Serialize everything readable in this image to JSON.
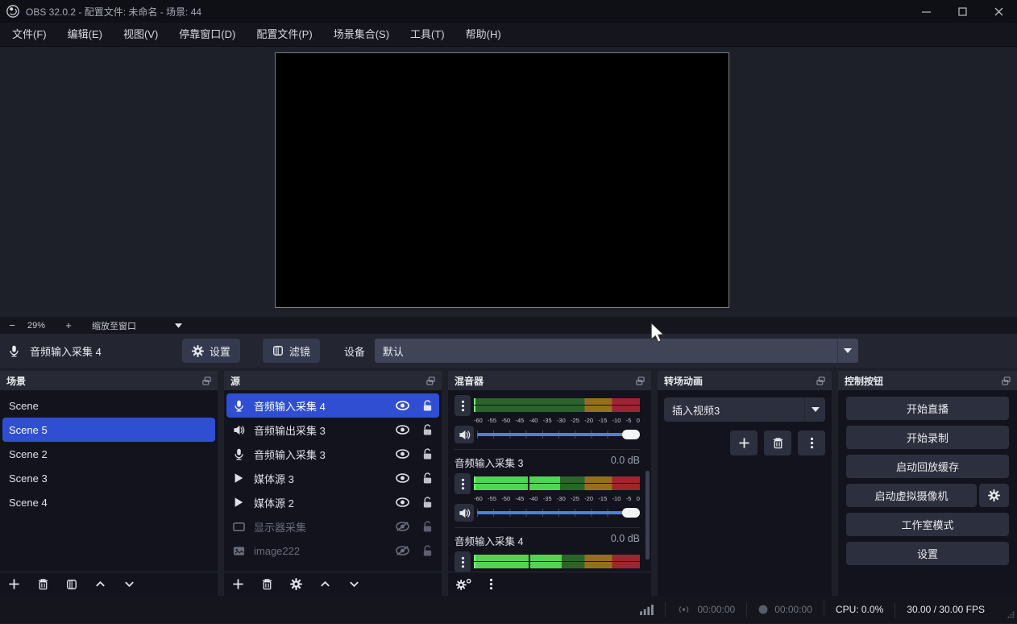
{
  "titlebar": {
    "title": "OBS 32.0.2 - 配置文件: 未命名 - 场景: 44"
  },
  "menubar": {
    "items": [
      "文件(F)",
      "编辑(E)",
      "视图(V)",
      "停靠窗口(D)",
      "配置文件(P)",
      "场景集合(S)",
      "工具(T)",
      "帮助(H)"
    ]
  },
  "preview": {
    "zoom_out": "−",
    "zoom_percent": "29%",
    "zoom_in": "+",
    "zoom_fit": "缩放至窗口"
  },
  "props_bar": {
    "source_name": "音频输入采集 4",
    "settings": "设置",
    "filters": "滤镜",
    "device_label": "设备",
    "device_value": "默认"
  },
  "docks": {
    "scenes": {
      "title": "场景",
      "items": [
        {
          "label": "Scene",
          "selected": false
        },
        {
          "label": "Scene 5",
          "selected": true
        },
        {
          "label": "Scene 2",
          "selected": false
        },
        {
          "label": "Scene 3",
          "selected": false
        },
        {
          "label": "Scene 4",
          "selected": false
        }
      ]
    },
    "sources": {
      "title": "源",
      "items": [
        {
          "label": "音频输入采集 4",
          "icon": "mic-icon",
          "selected": true,
          "visible": true,
          "dimmed": false
        },
        {
          "label": "音频输出采集 3",
          "icon": "speaker-icon",
          "selected": false,
          "visible": true,
          "dimmed": false
        },
        {
          "label": "音频输入采集 3",
          "icon": "mic-icon",
          "selected": false,
          "visible": true,
          "dimmed": false
        },
        {
          "label": "媒体源 3",
          "icon": "play-icon",
          "selected": false,
          "visible": true,
          "dimmed": false
        },
        {
          "label": "媒体源 2",
          "icon": "play-icon",
          "selected": false,
          "visible": true,
          "dimmed": false
        },
        {
          "label": "显示器采集",
          "icon": "monitor-icon",
          "selected": false,
          "visible": false,
          "dimmed": true
        },
        {
          "label": "image222",
          "icon": "image-icon",
          "selected": false,
          "visible": false,
          "dimmed": true
        }
      ]
    },
    "mixer": {
      "title": "混音器",
      "scale": [
        "-60",
        "-55",
        "-50",
        "-45",
        "-40",
        "-35",
        "-30",
        "-25",
        "-20",
        "-15",
        "-10",
        "-5",
        "0"
      ],
      "items": [
        {
          "label": "",
          "db": "",
          "label_visible": false,
          "level_pct": 1,
          "peak_pct": null,
          "volume_pct": 100
        },
        {
          "label": "音频输入采集 3",
          "db": "0.0 dB",
          "label_visible": true,
          "level_pct": 52,
          "peak_pct": 32.5,
          "volume_pct": 100
        },
        {
          "label": "音频输入采集 4",
          "db": "0.0 dB",
          "label_visible": true,
          "level_pct": 53,
          "peak_pct": 33,
          "volume_pct": 100
        }
      ]
    },
    "transitions": {
      "title": "转场动画",
      "selected": "插入视频3"
    },
    "controls": {
      "title": "控制按钮",
      "buttons": [
        {
          "label": "开始直播",
          "has_gear": false
        },
        {
          "label": "开始录制",
          "has_gear": false
        },
        {
          "label": "启动回放缓存",
          "has_gear": false
        },
        {
          "label": "启动虚拟摄像机",
          "has_gear": true
        },
        {
          "label": "工作室模式",
          "has_gear": false
        },
        {
          "label": "设置",
          "has_gear": false
        }
      ]
    }
  },
  "statusbar": {
    "stream_time": "00:00:00",
    "record_time": "00:00:00",
    "cpu": "CPU: 0.0%",
    "fps": "30.00 / 30.00 FPS"
  },
  "colors": {
    "accent": "#2f4ed2",
    "meter_green_active": "#52d452",
    "meter_green_bg": "#2a642a",
    "meter_yellow_bg": "#95701c",
    "meter_red_bg": "#9d2531",
    "slider_blue": "#4f80da"
  }
}
